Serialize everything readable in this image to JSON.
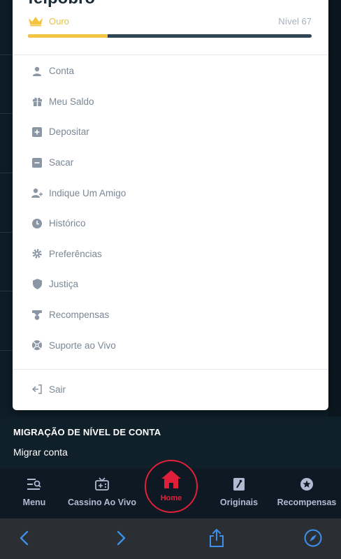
{
  "user": {
    "username": "felpobro",
    "rank": "Ouro",
    "level": "Nível 67",
    "progress": 0.28
  },
  "menu": {
    "items": [
      {
        "label": "Conta",
        "icon": "user-icon"
      },
      {
        "label": "Meu Saldo",
        "icon": "gift-icon"
      },
      {
        "label": "Depositar",
        "icon": "plus-square-icon"
      },
      {
        "label": "Sacar",
        "icon": "minus-square-icon"
      },
      {
        "label": "Indique Um Amigo",
        "icon": "user-plus-icon"
      },
      {
        "label": "Histórico",
        "icon": "clock-icon"
      },
      {
        "label": "Preferências",
        "icon": "gear-icon"
      },
      {
        "label": "Justiça",
        "icon": "shield-icon"
      },
      {
        "label": "Recompensas",
        "icon": "reward-icon"
      },
      {
        "label": "Suporte ao Vivo",
        "icon": "support-icon"
      }
    ],
    "logout": "Sair"
  },
  "migration": {
    "title": "MIGRAÇÃO DE NÍVEL DE CONTA",
    "subtitle": "Migrar conta"
  },
  "tabbar": {
    "menu": "Menu",
    "live_casino": "Cassino Ao Vivo",
    "home": "Home",
    "originals": "Originais",
    "rewards": "Recompensas"
  },
  "colors": {
    "accent": "#e0203b",
    "gold": "#f5c542",
    "panel": "#ffffff",
    "bar": "#0f1923"
  }
}
